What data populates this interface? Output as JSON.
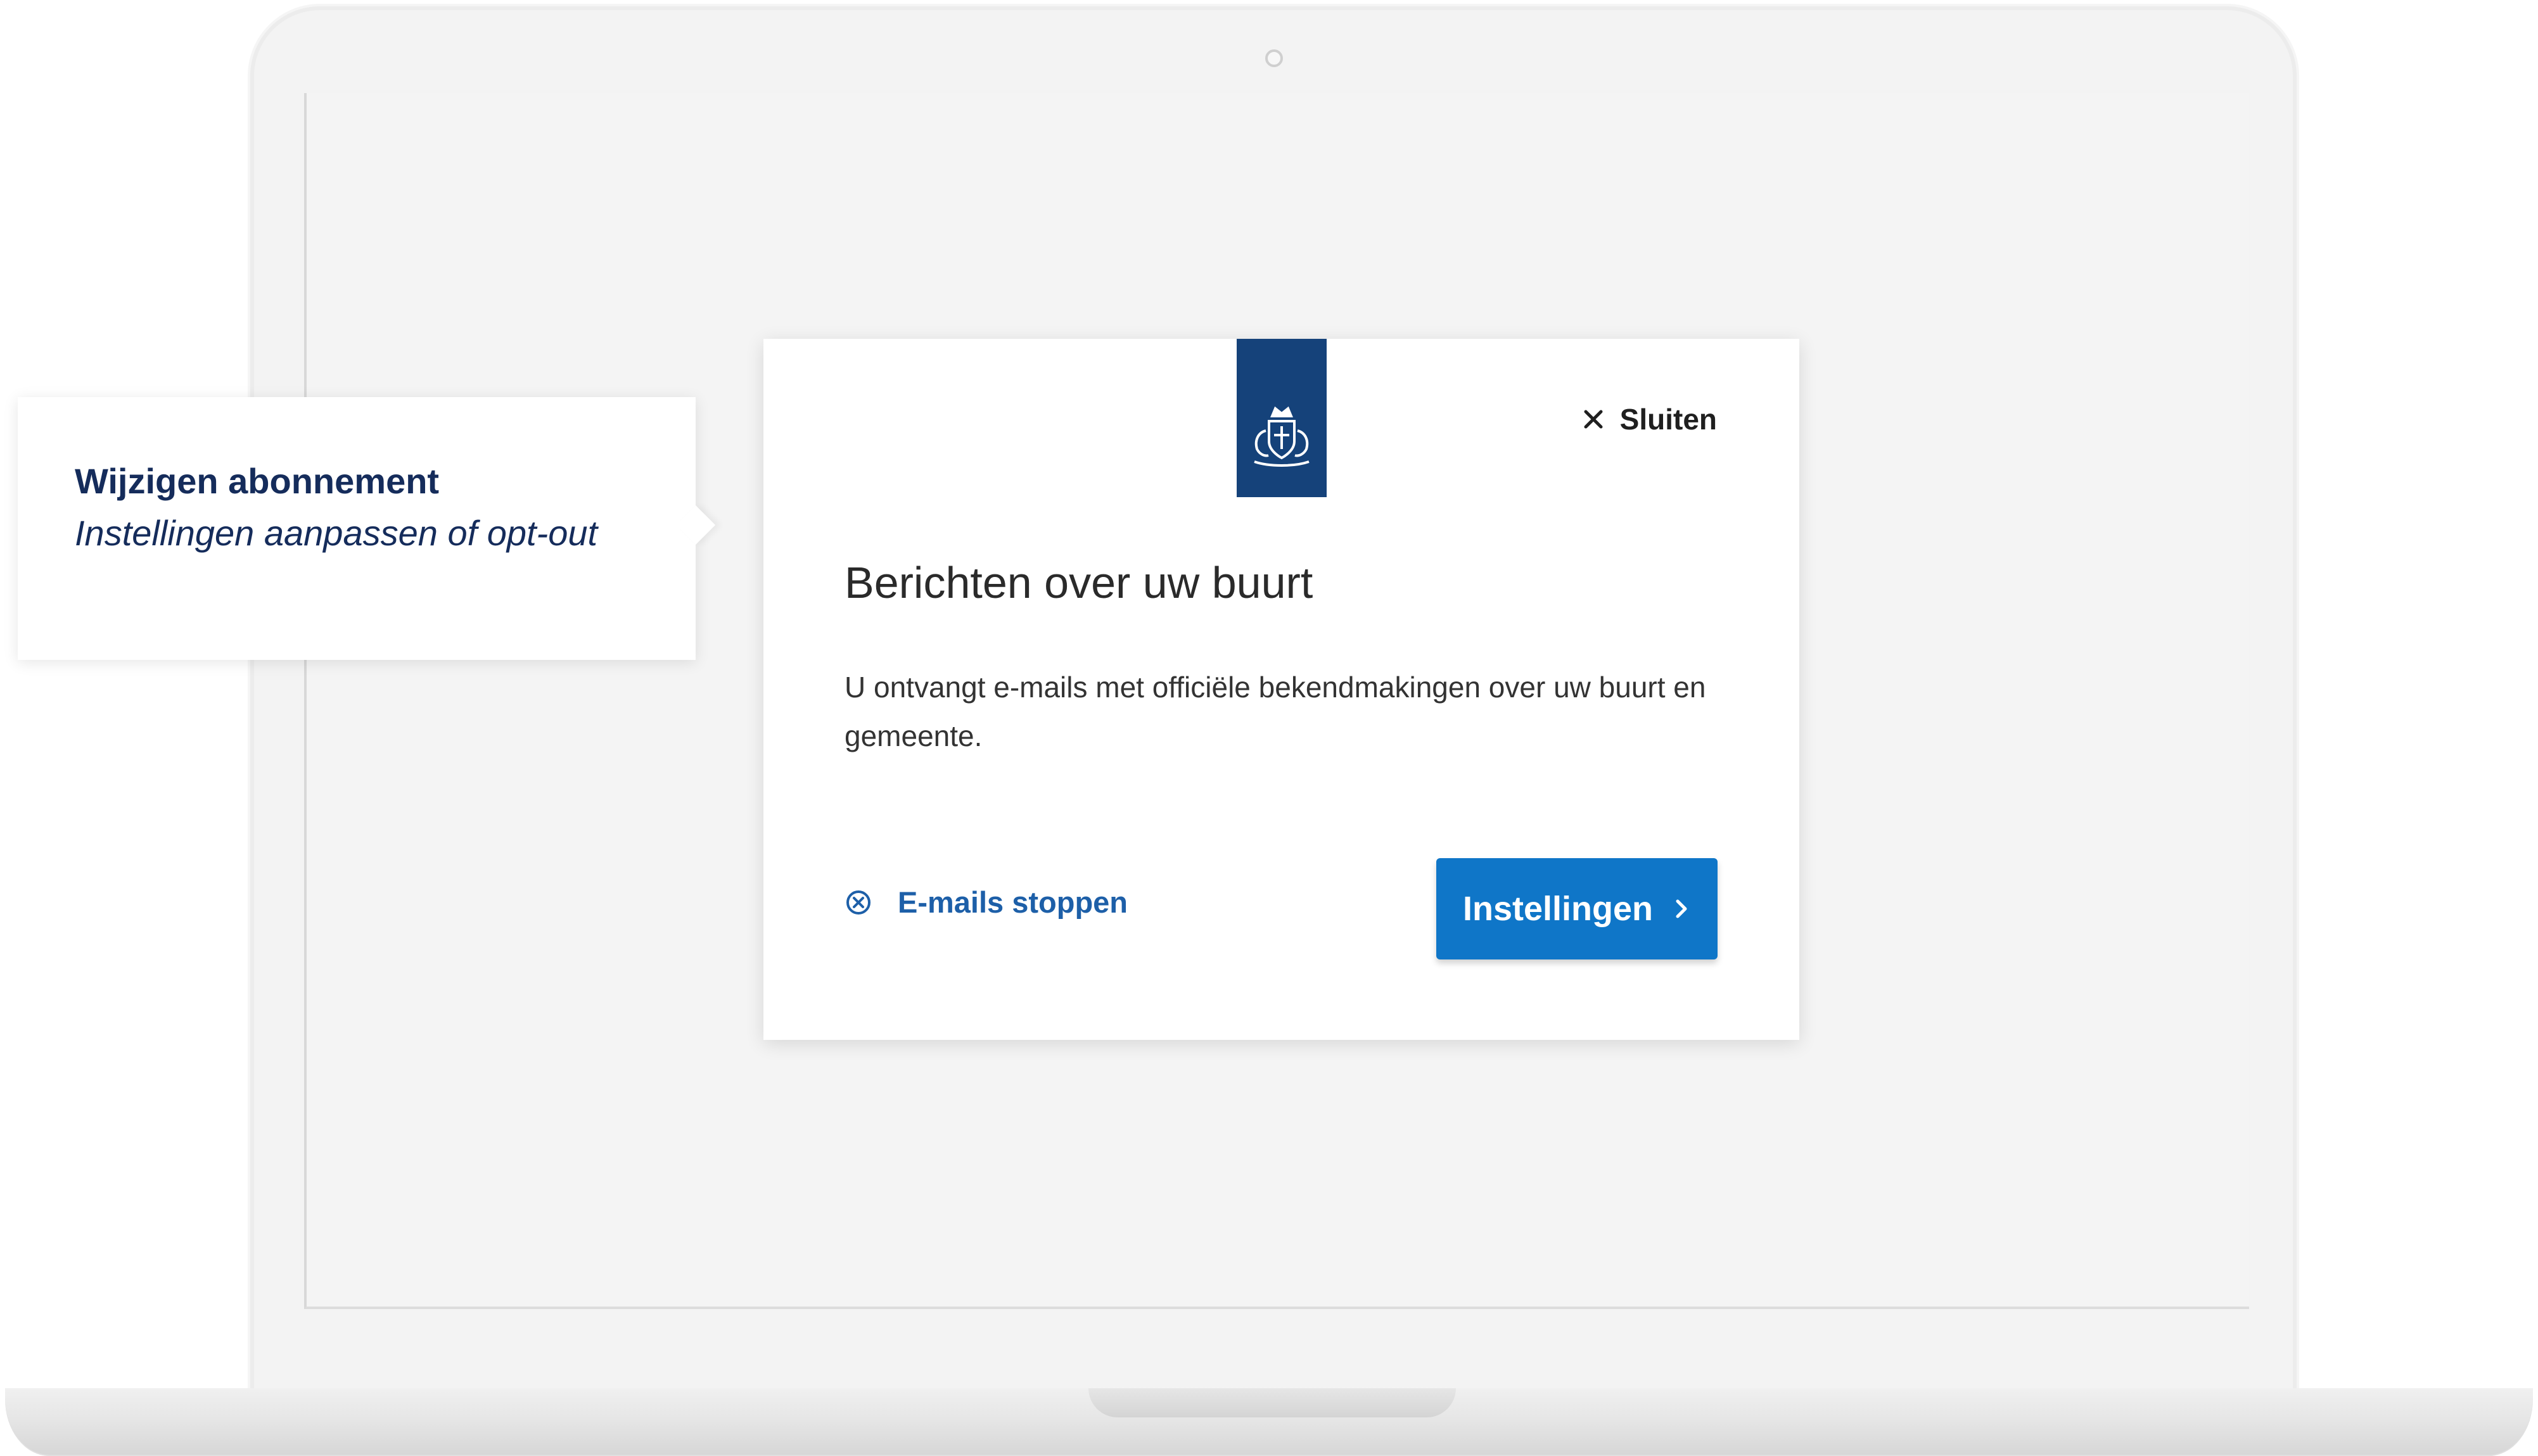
{
  "callout": {
    "title": "Wijzigen abonnement",
    "subtitle": "Instellingen aanpassen of opt-out"
  },
  "modal": {
    "logo_icon": "coat-of-arms-icon",
    "close_label": "Sluiten",
    "title": "Berichten over uw buurt",
    "body": "U ontvangt e-mails met officiële bekendmakingen over uw buurt en gemeente.",
    "stop_label": "E-mails stoppen",
    "settings_label": "Instellingen"
  },
  "colors": {
    "brand_blue": "#15427a",
    "primary_button": "#0f76c8",
    "link_blue": "#1d5fa8",
    "callout_text": "#152c5b"
  }
}
